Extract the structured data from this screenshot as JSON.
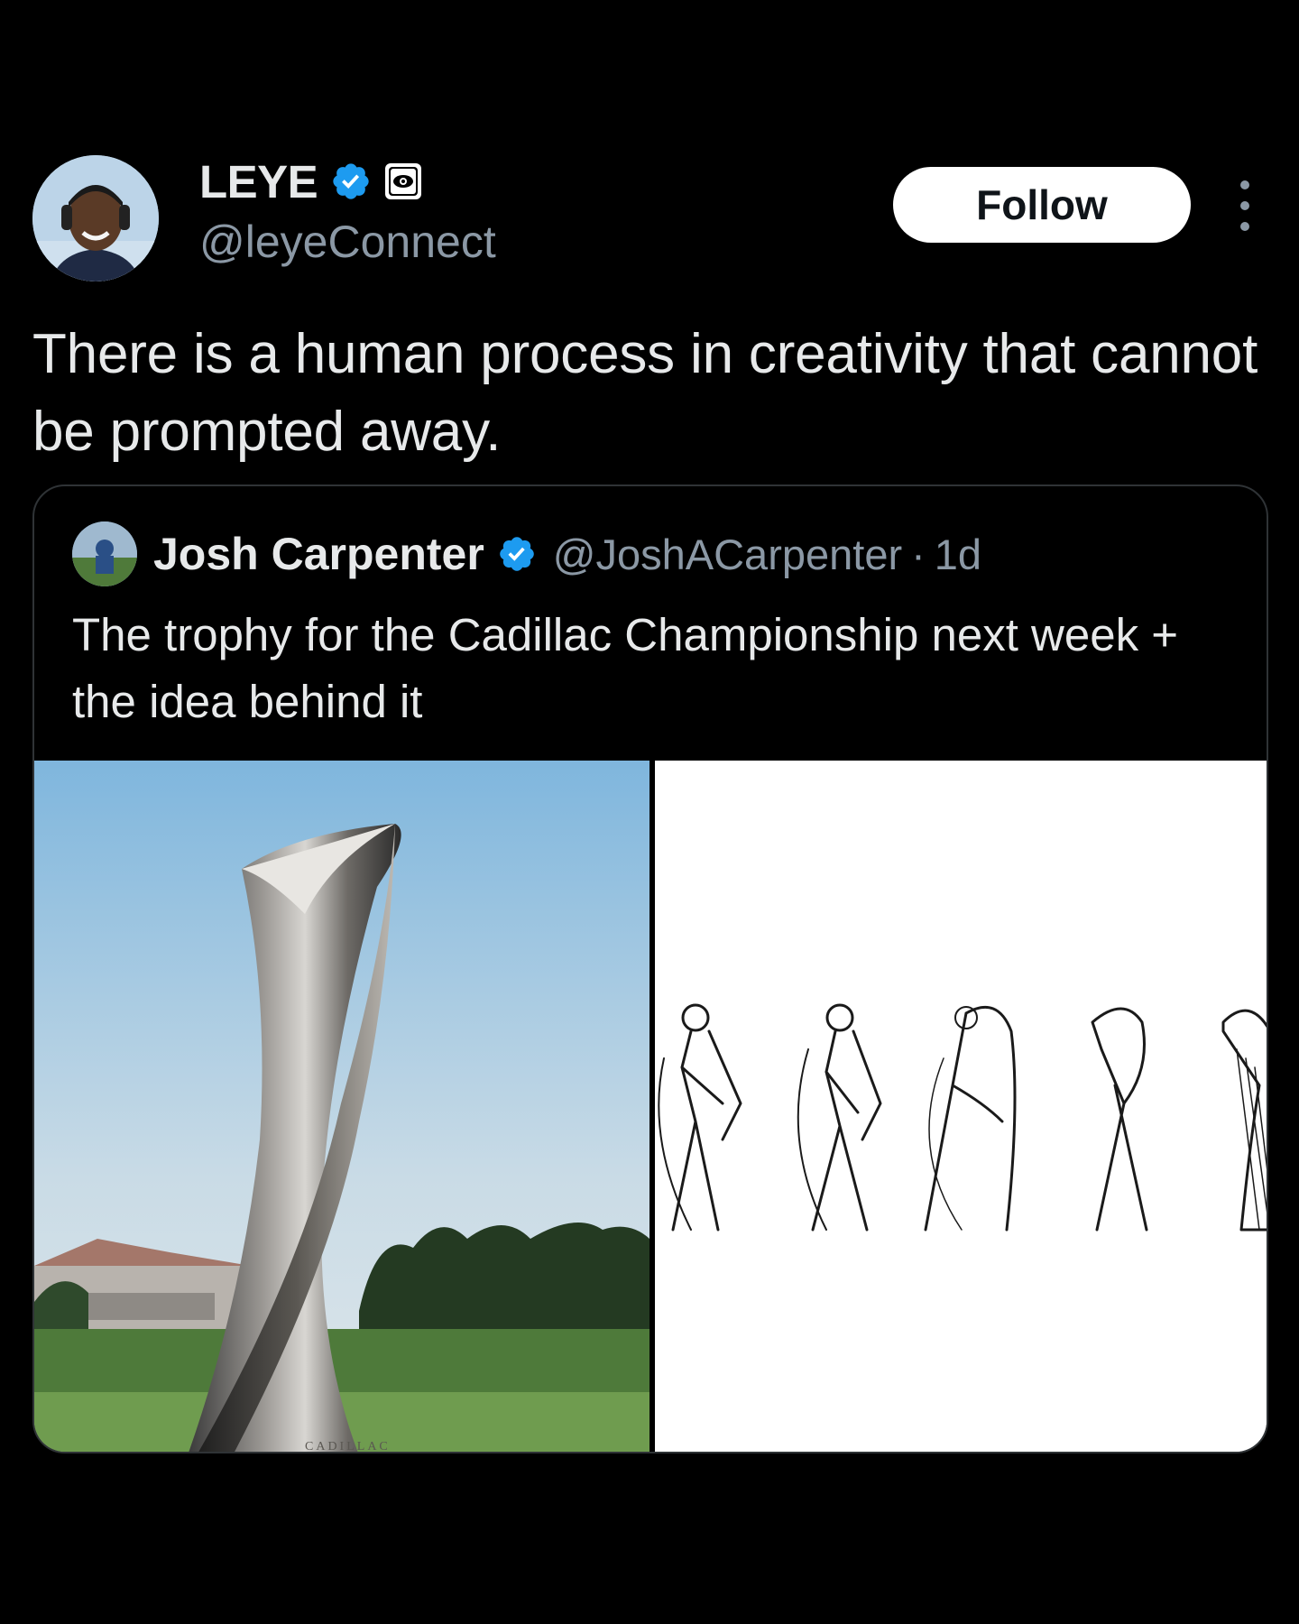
{
  "author": {
    "display_name": "LEYE",
    "handle": "@leyeConnect",
    "verified": true,
    "badge_icon": "affiliate-eye-icon"
  },
  "actions": {
    "follow_label": "Follow",
    "more_icon": "more-vertical-icon"
  },
  "tweet": {
    "text": "There is a human process in creativity that cannot be prompted away."
  },
  "quoted_tweet": {
    "display_name": "Josh Carpenter",
    "handle": "@JoshACarpenter",
    "separator": "·",
    "time": "1d",
    "verified": true,
    "text": "The trophy for the Cadillac Championship next week + the idea behind it",
    "media": [
      {
        "kind": "photo",
        "subject": "trophy-photo",
        "embedded_text": "CADILLAC"
      },
      {
        "kind": "photo",
        "subject": "golf-swing-sketches"
      }
    ]
  },
  "colors": {
    "background": "#000000",
    "text_primary": "#e7e9ea",
    "text_secondary": "#8b98a5",
    "verified_blue": "#1d9bf0",
    "follow_bg": "#ffffff",
    "border": "#2f3336"
  }
}
